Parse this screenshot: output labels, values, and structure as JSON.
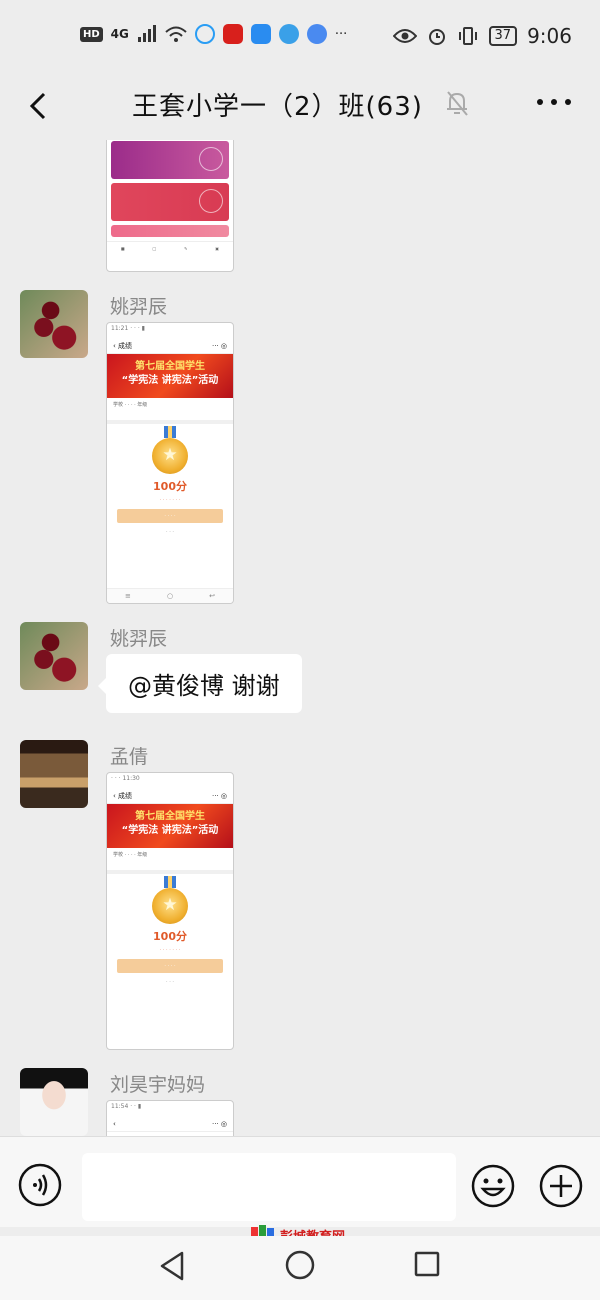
{
  "status_bar": {
    "hd": "HD",
    "signal": "4G",
    "time": "9:06",
    "battery": "37"
  },
  "header": {
    "title": "王套小学一（2）班(63)"
  },
  "messages": [
    {
      "type": "image",
      "desc": "previous screenshot (partial)"
    },
    {
      "type": "image",
      "sender": "姚羿辰",
      "banner_line1": "第七届全国学生",
      "banner_line2": "“学宪法 讲宪法”活动",
      "score": "100分"
    },
    {
      "type": "text",
      "sender": "姚羿辰",
      "text": "@黄俊博  谢谢"
    },
    {
      "type": "image",
      "sender": "孟倩",
      "banner_line1": "第七届全国学生",
      "banner_line2": "“学宪法 讲宪法”活动",
      "score": "100分"
    },
    {
      "type": "image",
      "sender": "刘昊宇妈妈"
    }
  ],
  "watermark": "彭城教育网"
}
